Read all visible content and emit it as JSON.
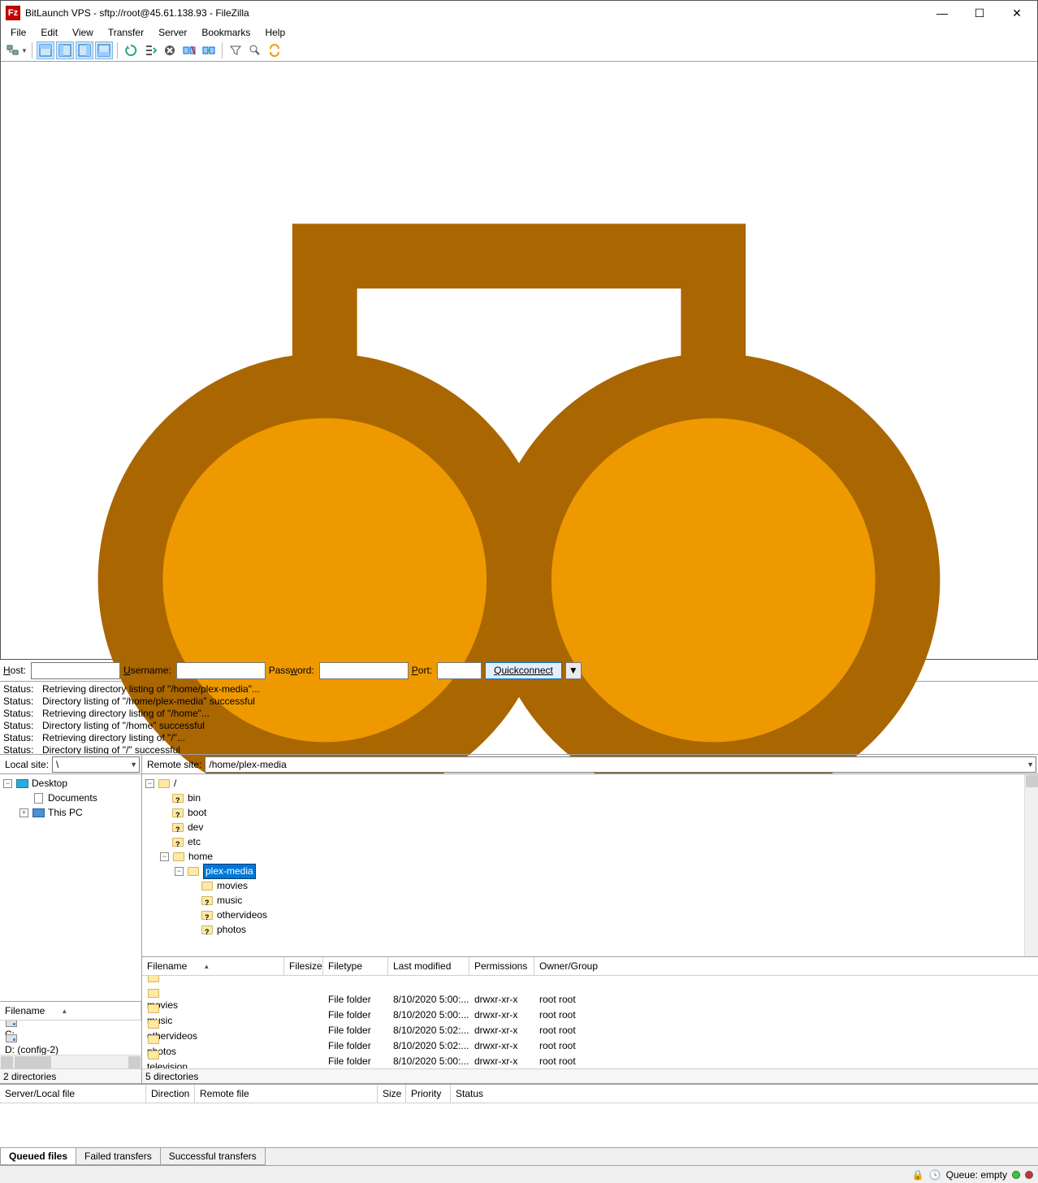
{
  "title": "BitLaunch VPS - sftp://root@45.61.138.93 - FileZilla",
  "menu": [
    "File",
    "Edit",
    "View",
    "Transfer",
    "Server",
    "Bookmarks",
    "Help"
  ],
  "qc": {
    "host_lbl": "Host:",
    "user_lbl": "Username:",
    "pass_lbl": "Password:",
    "port_lbl": "Port:",
    "btn": "Quickconnect"
  },
  "log": [
    {
      "s": "Status:",
      "m": "Retrieving directory listing of \"/home/plex-media\"..."
    },
    {
      "s": "Status:",
      "m": "Directory listing of \"/home/plex-media\" successful"
    },
    {
      "s": "Status:",
      "m": "Retrieving directory listing of \"/home\"..."
    },
    {
      "s": "Status:",
      "m": "Directory listing of \"/home\" successful"
    },
    {
      "s": "Status:",
      "m": "Retrieving directory listing of \"/\"..."
    },
    {
      "s": "Status:",
      "m": "Directory listing of \"/\" successful"
    }
  ],
  "local": {
    "label": "Local site:",
    "path": "\\",
    "tree": {
      "desktop": "Desktop",
      "documents": "Documents",
      "thispc": "This PC"
    },
    "list_hdr": "Filename",
    "drives": [
      {
        "name": "C:"
      },
      {
        "name": "D: (config-2)"
      }
    ],
    "status": "2 directories"
  },
  "remote": {
    "label": "Remote site:",
    "path": "/home/plex-media",
    "tree": {
      "root": "/",
      "bin": "bin",
      "boot": "boot",
      "dev": "dev",
      "etc": "etc",
      "home": "home",
      "plex": "plex-media",
      "movies": "movies",
      "music": "music",
      "other": "othervideos",
      "photos": "photos"
    },
    "cols": [
      "Filename",
      "Filesize",
      "Filetype",
      "Last modified",
      "Permissions",
      "Owner/Group"
    ],
    "rows": [
      {
        "n": "..",
        "t": "",
        "m": "",
        "p": "",
        "o": ""
      },
      {
        "n": "movies",
        "t": "File folder",
        "m": "8/10/2020 5:00:...",
        "p": "drwxr-xr-x",
        "o": "root root"
      },
      {
        "n": "music",
        "t": "File folder",
        "m": "8/10/2020 5:00:...",
        "p": "drwxr-xr-x",
        "o": "root root"
      },
      {
        "n": "othervideos",
        "t": "File folder",
        "m": "8/10/2020 5:02:...",
        "p": "drwxr-xr-x",
        "o": "root root"
      },
      {
        "n": "photos",
        "t": "File folder",
        "m": "8/10/2020 5:02:...",
        "p": "drwxr-xr-x",
        "o": "root root"
      },
      {
        "n": "television",
        "t": "File folder",
        "m": "8/10/2020 5:00:...",
        "p": "drwxr-xr-x",
        "o": "root root"
      }
    ],
    "status": "5 directories"
  },
  "queue": {
    "cols": [
      "Server/Local file",
      "Direction",
      "Remote file",
      "Size",
      "Priority",
      "Status"
    ],
    "tabs": [
      "Queued files",
      "Failed transfers",
      "Successful transfers"
    ]
  },
  "statusbar": {
    "queue": "Queue: empty"
  }
}
